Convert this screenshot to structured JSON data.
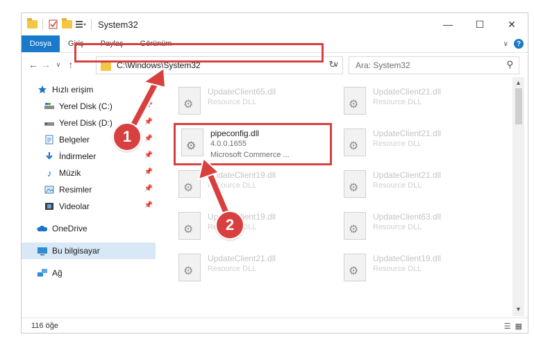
{
  "window": {
    "title": "System32"
  },
  "ribbon": {
    "tabs": [
      "Dosya",
      "Giriş",
      "Paylaş",
      "Görünüm"
    ]
  },
  "address": {
    "path": "C:\\Windows\\System32"
  },
  "search": {
    "placeholder": "Ara: System32"
  },
  "sidebar": {
    "items": [
      {
        "label": "Hızlı erişim",
        "icon": "star-icon"
      },
      {
        "label": "Yerel Disk (C:)",
        "icon": "drive-icon"
      },
      {
        "label": "Yerel Disk (D:)",
        "icon": "drive-icon"
      },
      {
        "label": "Belgeler",
        "icon": "document-icon"
      },
      {
        "label": "İndirmeler",
        "icon": "download-icon"
      },
      {
        "label": "Müzik",
        "icon": "music-icon"
      },
      {
        "label": "Resimler",
        "icon": "pictures-icon"
      },
      {
        "label": "Videolar",
        "icon": "video-icon"
      },
      {
        "label": "OneDrive",
        "icon": "cloud-icon"
      },
      {
        "label": "Bu bilgisayar",
        "icon": "computer-icon"
      },
      {
        "label": "Ağ",
        "icon": "network-icon"
      }
    ]
  },
  "files": {
    "focused": {
      "name": "pipeconfig.dll",
      "version": "4.0.0.1655",
      "description": "Microsoft Commerce ..."
    },
    "background": [
      {
        "name": "UpdateClient65.dll",
        "desc": "Resource DLL"
      },
      {
        "name": "UpdateClient21.dll",
        "desc": "Resource DLL"
      },
      {
        "name": "UpdateClient21.dll",
        "desc": "Resource DLL"
      },
      {
        "name": "UpdateClient21.dll",
        "desc": "Resource DLL"
      },
      {
        "name": "UpdateClient19.dll",
        "desc": "Resource DLL"
      },
      {
        "name": "UpdateClient19.dll",
        "desc": "Resource DLL"
      },
      {
        "name": "UpdateClient63.dll",
        "desc": "Resource DLL"
      },
      {
        "name": "UpdateClient21.dll",
        "desc": "Resource DLL"
      },
      {
        "name": "UpdateClient19.dll",
        "desc": "Resource DLL"
      }
    ]
  },
  "status": {
    "count": "116 öğe"
  },
  "callouts": [
    "1",
    "2"
  ],
  "colors": {
    "accent": "#1979ca",
    "highlight": "#d6403f"
  }
}
